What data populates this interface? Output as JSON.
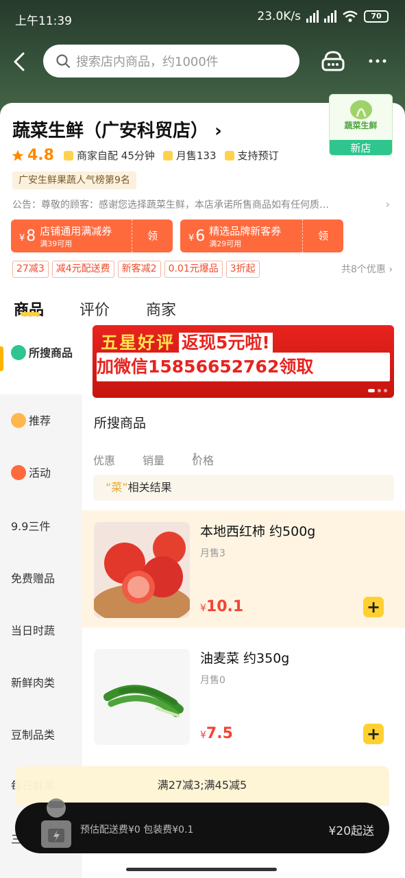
{
  "status_bar": {
    "time": "上午11:39",
    "net_speed": "23.0K/s",
    "net_type": "HD",
    "battery": "70"
  },
  "search": {
    "placeholder": "搜索店内商品，约1000件"
  },
  "store": {
    "name": "蔬菜生鲜（广安科贸店）",
    "logo_text": "蔬菜生鲜",
    "logo_badge": "新店",
    "rating": "4.8",
    "delivery": "商家自配",
    "delivery_time": "45分钟",
    "monthly_sales": "月售133",
    "preorder": "支持预订",
    "rank": "广安生鲜果蔬人气榜第9名",
    "notice": "公告：尊敬的顾客：感谢您选择蔬菜生鲜，本店承诺所售商品如有任何质…"
  },
  "coupons": [
    {
      "currency": "¥",
      "amount": "8",
      "title": "店铺通用满减券",
      "cond": "满39可用",
      "claim": "领"
    },
    {
      "currency": "¥",
      "amount": "6",
      "title": "精选品牌新客券",
      "cond": "满29可用",
      "claim": "领"
    }
  ],
  "promos": [
    "27减3",
    "减4元配送费",
    "新客减2",
    "0.01元爆品",
    "3折起"
  ],
  "promo_more": "共8个优惠",
  "tabs": [
    "商品",
    "评价",
    "商家"
  ],
  "sidebar": [
    {
      "label": "所搜商品",
      "icon": "search-icon",
      "color": "#2ec58e"
    },
    {
      "label": "推荐",
      "icon": "recommend-icon",
      "color": "#ffb74d"
    },
    {
      "label": "活动",
      "icon": "activity-icon",
      "color": "#ff6a3d"
    },
    {
      "label": "9.9三件"
    },
    {
      "label": "免费赠品"
    },
    {
      "label": "当日时蔬"
    },
    {
      "label": "新鲜肉类"
    },
    {
      "label": "豆制品类"
    },
    {
      "label": "每日鲜果"
    },
    {
      "label": "三"
    }
  ],
  "banner": {
    "line1_a": "五星好评",
    "line1_b": "返现5元啦!",
    "line2": "加微信15856652762领取"
  },
  "section_title": "所搜商品",
  "sort": {
    "discount": "优惠",
    "sales": "销量",
    "price": "价格"
  },
  "result": {
    "open": "“",
    "keyword": "菜",
    "close": "”",
    "suffix": "相关结果"
  },
  "products": [
    {
      "name": "本地西红柿 约500g",
      "sales": "月售3",
      "currency": "¥",
      "price": "10.1"
    },
    {
      "name": "油麦菜 约350g",
      "sales": "月售0",
      "currency": "¥",
      "price": "7.5"
    }
  ],
  "promo_strip": "满27减3;满45减5",
  "cart": {
    "fee": "预估配送费¥0 包装费¥0.1",
    "min": "¥20起送"
  },
  "colors": {
    "accent": "#ffcf33",
    "price": "#f44336",
    "coupon": "#ff6a3d",
    "brand_green": "#2ec58e"
  }
}
